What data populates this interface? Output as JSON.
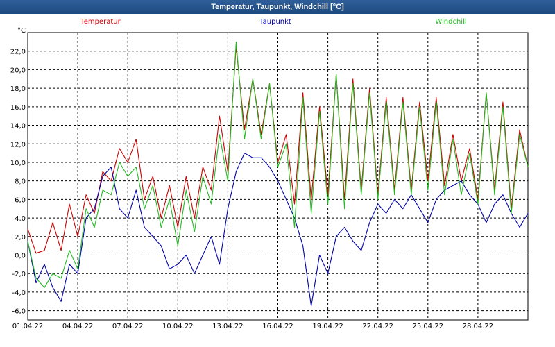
{
  "window": {
    "title": "Temperatur, Taupunkt, Windchill [°C]"
  },
  "chart_data": {
    "type": "line",
    "title": "Temperatur, Taupunkt, Windchill [°C]",
    "ylabel": "°C",
    "xlabel": "",
    "ylim": [
      -7,
      24
    ],
    "xlim": [
      "2022-04-01",
      "2022-05-01"
    ],
    "y_ticks": [
      "22,0",
      "20,0",
      "18,0",
      "16,0",
      "14,0",
      "12,0",
      "10,0",
      "8,0",
      "6,0",
      "4,0",
      "2,0",
      "0,0",
      "-2,0",
      "-4,0",
      "-6,0"
    ],
    "x_ticks": [
      "01.04.22",
      "04.04.22",
      "07.04.22",
      "10.04.22",
      "13.04.22",
      "16.04.22",
      "19.04.22",
      "22.04.22",
      "25.04.22",
      "28.04.22"
    ],
    "grid": true,
    "legend_position": "top",
    "x": [
      "2022-04-01 00:00",
      "2022-04-01 12:00",
      "2022-04-02 00:00",
      "2022-04-02 12:00",
      "2022-04-03 00:00",
      "2022-04-03 12:00",
      "2022-04-04 00:00",
      "2022-04-04 12:00",
      "2022-04-05 00:00",
      "2022-04-05 12:00",
      "2022-04-06 00:00",
      "2022-04-06 12:00",
      "2022-04-07 00:00",
      "2022-04-07 12:00",
      "2022-04-08 00:00",
      "2022-04-08 12:00",
      "2022-04-09 00:00",
      "2022-04-09 12:00",
      "2022-04-10 00:00",
      "2022-04-10 12:00",
      "2022-04-11 00:00",
      "2022-04-11 12:00",
      "2022-04-12 00:00",
      "2022-04-12 12:00",
      "2022-04-13 00:00",
      "2022-04-13 12:00",
      "2022-04-14 00:00",
      "2022-04-14 12:00",
      "2022-04-15 00:00",
      "2022-04-15 12:00",
      "2022-04-16 00:00",
      "2022-04-16 12:00",
      "2022-04-17 00:00",
      "2022-04-17 12:00",
      "2022-04-18 00:00",
      "2022-04-18 12:00",
      "2022-04-19 00:00",
      "2022-04-19 12:00",
      "2022-04-20 00:00",
      "2022-04-20 12:00",
      "2022-04-21 00:00",
      "2022-04-21 12:00",
      "2022-04-22 00:00",
      "2022-04-22 12:00",
      "2022-04-23 00:00",
      "2022-04-23 12:00",
      "2022-04-24 00:00",
      "2022-04-24 12:00",
      "2022-04-25 00:00",
      "2022-04-25 12:00",
      "2022-04-26 00:00",
      "2022-04-26 12:00",
      "2022-04-27 00:00",
      "2022-04-27 12:00",
      "2022-04-28 00:00",
      "2022-04-28 12:00",
      "2022-04-29 00:00",
      "2022-04-29 12:00",
      "2022-04-30 00:00",
      "2022-04-30 12:00",
      "2022-05-01 00:00"
    ],
    "series": [
      {
        "name": "Temperatur",
        "color": "#cc0000",
        "values": [
          2.8,
          0.2,
          0.5,
          3.5,
          0.5,
          5.5,
          2.0,
          6.5,
          4.5,
          9.0,
          8.0,
          11.5,
          10.0,
          12.5,
          6.0,
          8.5,
          4.0,
          7.5,
          3.0,
          8.5,
          4.0,
          9.5,
          7.0,
          15.0,
          9.0,
          22.5,
          13.5,
          19.0,
          13.0,
          18.5,
          10.0,
          13.0,
          5.5,
          17.5,
          6.0,
          16.0,
          6.5,
          19.5,
          6.0,
          19.0,
          7.0,
          18.0,
          6.5,
          17.0,
          7.0,
          17.0,
          7.0,
          16.5,
          8.0,
          17.0,
          7.5,
          13.0,
          8.0,
          11.5,
          6.0,
          17.5,
          7.0,
          16.5,
          5.0,
          13.5,
          9.5
        ]
      },
      {
        "name": "Taupunkt",
        "color": "#0000aa",
        "values": [
          1.5,
          -3.0,
          -1.0,
          -3.5,
          -5.0,
          -1.0,
          -2.0,
          4.0,
          5.0,
          8.5,
          9.5,
          5.0,
          4.0,
          7.0,
          3.0,
          2.0,
          1.0,
          -1.5,
          -1.0,
          0.0,
          -2.0,
          0.0,
          2.0,
          -1.0,
          5.0,
          9.0,
          11.0,
          10.5,
          10.5,
          9.5,
          8.0,
          6.0,
          4.0,
          1.0,
          -5.5,
          0.0,
          -2.0,
          2.0,
          3.0,
          1.5,
          0.5,
          3.5,
          5.5,
          4.5,
          6.0,
          5.0,
          6.5,
          5.0,
          3.5,
          6.0,
          7.0,
          7.5,
          8.0,
          6.5,
          5.5,
          3.5,
          5.5,
          6.5,
          4.5,
          3.0,
          4.5
        ]
      },
      {
        "name": "Windchill",
        "color": "#22bb22",
        "values": [
          1.5,
          -2.5,
          -3.5,
          -2.0,
          -2.5,
          0.5,
          -1.5,
          5.0,
          3.0,
          7.0,
          6.5,
          10.0,
          8.5,
          9.5,
          5.0,
          7.5,
          3.0,
          6.0,
          1.0,
          7.0,
          2.5,
          8.5,
          5.5,
          13.0,
          8.0,
          23.0,
          12.5,
          19.0,
          12.5,
          18.5,
          9.5,
          12.0,
          3.0,
          17.0,
          4.5,
          15.5,
          5.5,
          19.5,
          5.0,
          18.5,
          6.5,
          17.5,
          6.0,
          16.5,
          6.5,
          16.5,
          6.5,
          16.0,
          7.0,
          16.5,
          6.5,
          12.5,
          6.5,
          11.0,
          5.5,
          17.5,
          6.5,
          16.0,
          4.5,
          13.0,
          9.5
        ]
      }
    ]
  }
}
